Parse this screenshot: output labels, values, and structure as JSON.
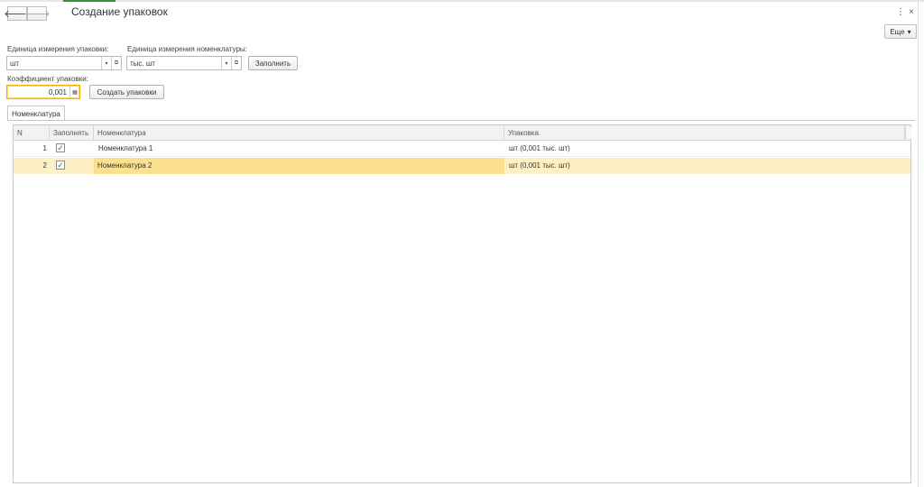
{
  "window": {
    "title": "Создание упаковок",
    "nav_back": "🡐",
    "nav_forward": "🡒",
    "menu_icon": "⋮",
    "close_icon": "×"
  },
  "toolbar": {
    "more_label": "Еще",
    "more_chevron": "▾"
  },
  "form": {
    "package_unit_label": "Единица измерения упаковки:",
    "package_unit_value": "шт",
    "item_unit_label": "Единица измерения номенклатуры:",
    "item_unit_value": "тыс. шт",
    "fill_button": "Заполнить",
    "coefficient_label": "Коэффициент упаковки:",
    "coefficient_value": "0,001",
    "create_button": "Создать упаковки",
    "dropdown_icon": "▾",
    "open_icon": "⧉",
    "calc_icon": "▦"
  },
  "tabs": [
    {
      "label": "Номенклатура",
      "active": true
    }
  ],
  "table": {
    "columns": [
      "N",
      "Заполнять",
      "Номенклатура",
      "Упаковка"
    ],
    "rows": [
      {
        "n": "1",
        "checked": true,
        "item": "Номенклатура 1",
        "package": "шт (0,001 тыс. шт)",
        "selected": false
      },
      {
        "n": "2",
        "checked": true,
        "item": "Номенклатура 2",
        "package": "шт (0,001 тыс. шт)",
        "selected": true
      }
    ],
    "check_mark": "✓"
  },
  "colors": {
    "accent": "#3a8f3a",
    "focus_border": "#f0b400",
    "selected_row": "#fdf0c4",
    "selected_cell": "#fbe18f"
  }
}
